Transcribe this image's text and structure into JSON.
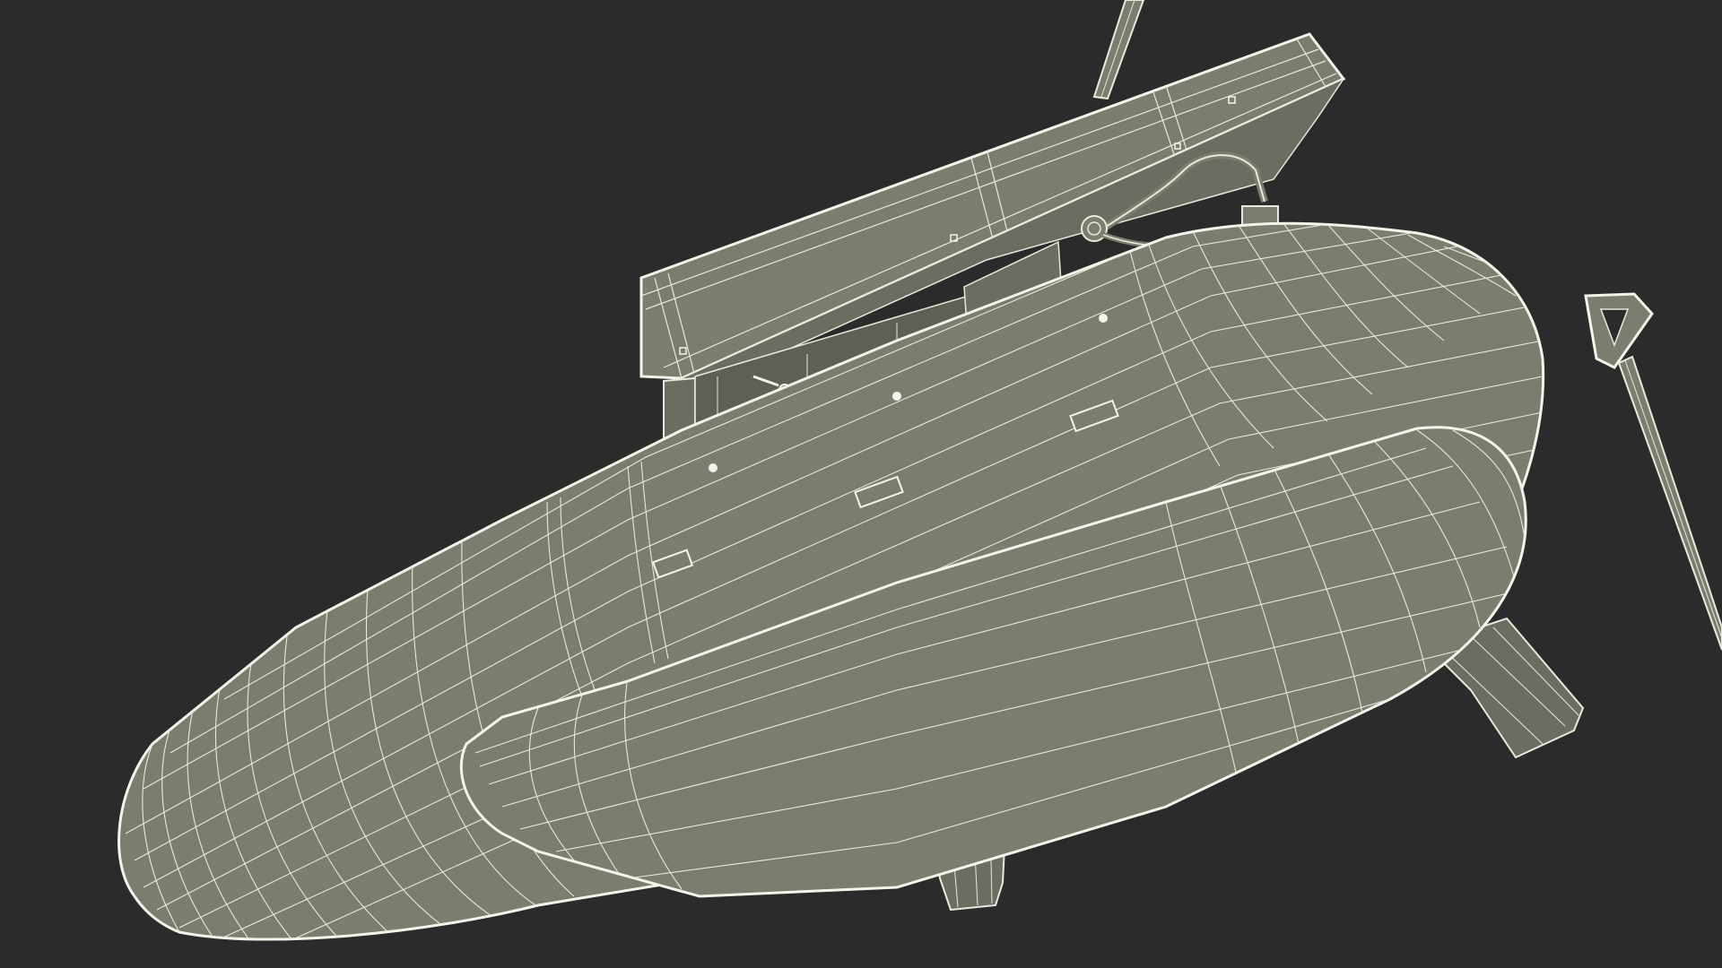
{
  "scene": {
    "background": "#2b2b2b",
    "mesh_fill": "#7c7d6f",
    "mesh_fill_dark": "#6c6d60",
    "wire_color": "#e9e9dc",
    "edge_color": "#f4f4ea",
    "render_style": "wireframe-over-shaded",
    "objects": [
      "inflatable-float-hull",
      "lower-float-tube",
      "raised-console-panel",
      "support-bracket-frame",
      "hose-fitting",
      "tow-handle-rod",
      "mast-pole",
      "rear-skid-fin",
      "front-leg-stand"
    ]
  }
}
